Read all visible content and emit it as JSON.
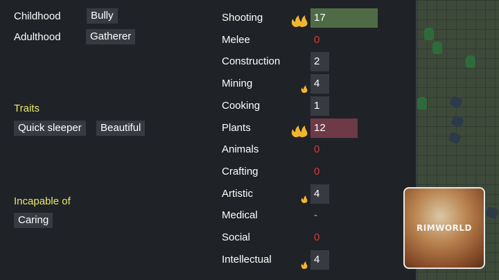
{
  "backstory": {
    "childhood_label": "Childhood",
    "childhood_value": "Bully",
    "adulthood_label": "Adulthood",
    "adulthood_value": "Gatherer"
  },
  "traits": {
    "heading": "Traits",
    "items": [
      "Quick sleeper",
      "Beautiful"
    ]
  },
  "incapable": {
    "heading": "Incapable of",
    "items": [
      "Caring"
    ]
  },
  "skills": [
    {
      "name": "Shooting",
      "passion": "major",
      "value": "17",
      "bar_fraction": 0.85,
      "bar_color": "#4f6b45"
    },
    {
      "name": "Melee",
      "passion": "none",
      "value": "0",
      "bar_fraction": 0,
      "bar_color": ""
    },
    {
      "name": "Construction",
      "passion": "none",
      "value": "2",
      "bar_fraction": 0.1,
      "bar_color": "#373b41"
    },
    {
      "name": "Mining",
      "passion": "minor",
      "value": "4",
      "bar_fraction": 0.2,
      "bar_color": "#373b41"
    },
    {
      "name": "Cooking",
      "passion": "none",
      "value": "1",
      "bar_fraction": 0.05,
      "bar_color": "#373b41"
    },
    {
      "name": "Plants",
      "passion": "major",
      "value": "12",
      "bar_fraction": 0.6,
      "bar_color": "#6e3a47"
    },
    {
      "name": "Animals",
      "passion": "none",
      "value": "0",
      "bar_fraction": 0,
      "bar_color": ""
    },
    {
      "name": "Crafting",
      "passion": "none",
      "value": "0",
      "bar_fraction": 0,
      "bar_color": ""
    },
    {
      "name": "Artistic",
      "passion": "minor",
      "value": "4",
      "bar_fraction": 0.2,
      "bar_color": "#373b41"
    },
    {
      "name": "Medical",
      "passion": "none",
      "value": "-",
      "bar_fraction": 0,
      "bar_color": ""
    },
    {
      "name": "Social",
      "passion": "none",
      "value": "0",
      "bar_fraction": 0,
      "bar_color": ""
    },
    {
      "name": "Intellectual",
      "passion": "minor",
      "value": "4",
      "bar_fraction": 0.2,
      "bar_color": "#373b41"
    }
  ],
  "logo_text": "RIMWORLD",
  "colors": {
    "heading": "#e8e870",
    "zero_value": "#d83a3a",
    "flame": "#f2b531"
  }
}
